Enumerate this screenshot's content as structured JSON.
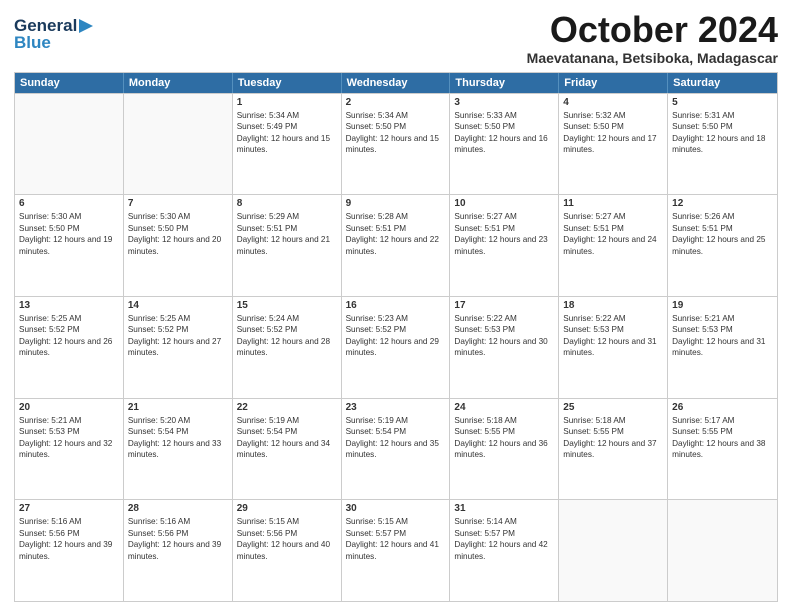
{
  "logo": {
    "line1": "General",
    "line2": "Blue"
  },
  "header": {
    "month": "October 2024",
    "location": "Maevatanana, Betsiboka, Madagascar"
  },
  "weekdays": [
    "Sunday",
    "Monday",
    "Tuesday",
    "Wednesday",
    "Thursday",
    "Friday",
    "Saturday"
  ],
  "weeks": [
    [
      {
        "day": "",
        "sunrise": "",
        "sunset": "",
        "daylight": ""
      },
      {
        "day": "",
        "sunrise": "",
        "sunset": "",
        "daylight": ""
      },
      {
        "day": "1",
        "sunrise": "Sunrise: 5:34 AM",
        "sunset": "Sunset: 5:49 PM",
        "daylight": "Daylight: 12 hours and 15 minutes."
      },
      {
        "day": "2",
        "sunrise": "Sunrise: 5:34 AM",
        "sunset": "Sunset: 5:50 PM",
        "daylight": "Daylight: 12 hours and 15 minutes."
      },
      {
        "day": "3",
        "sunrise": "Sunrise: 5:33 AM",
        "sunset": "Sunset: 5:50 PM",
        "daylight": "Daylight: 12 hours and 16 minutes."
      },
      {
        "day": "4",
        "sunrise": "Sunrise: 5:32 AM",
        "sunset": "Sunset: 5:50 PM",
        "daylight": "Daylight: 12 hours and 17 minutes."
      },
      {
        "day": "5",
        "sunrise": "Sunrise: 5:31 AM",
        "sunset": "Sunset: 5:50 PM",
        "daylight": "Daylight: 12 hours and 18 minutes."
      }
    ],
    [
      {
        "day": "6",
        "sunrise": "Sunrise: 5:30 AM",
        "sunset": "Sunset: 5:50 PM",
        "daylight": "Daylight: 12 hours and 19 minutes."
      },
      {
        "day": "7",
        "sunrise": "Sunrise: 5:30 AM",
        "sunset": "Sunset: 5:50 PM",
        "daylight": "Daylight: 12 hours and 20 minutes."
      },
      {
        "day": "8",
        "sunrise": "Sunrise: 5:29 AM",
        "sunset": "Sunset: 5:51 PM",
        "daylight": "Daylight: 12 hours and 21 minutes."
      },
      {
        "day": "9",
        "sunrise": "Sunrise: 5:28 AM",
        "sunset": "Sunset: 5:51 PM",
        "daylight": "Daylight: 12 hours and 22 minutes."
      },
      {
        "day": "10",
        "sunrise": "Sunrise: 5:27 AM",
        "sunset": "Sunset: 5:51 PM",
        "daylight": "Daylight: 12 hours and 23 minutes."
      },
      {
        "day": "11",
        "sunrise": "Sunrise: 5:27 AM",
        "sunset": "Sunset: 5:51 PM",
        "daylight": "Daylight: 12 hours and 24 minutes."
      },
      {
        "day": "12",
        "sunrise": "Sunrise: 5:26 AM",
        "sunset": "Sunset: 5:51 PM",
        "daylight": "Daylight: 12 hours and 25 minutes."
      }
    ],
    [
      {
        "day": "13",
        "sunrise": "Sunrise: 5:25 AM",
        "sunset": "Sunset: 5:52 PM",
        "daylight": "Daylight: 12 hours and 26 minutes."
      },
      {
        "day": "14",
        "sunrise": "Sunrise: 5:25 AM",
        "sunset": "Sunset: 5:52 PM",
        "daylight": "Daylight: 12 hours and 27 minutes."
      },
      {
        "day": "15",
        "sunrise": "Sunrise: 5:24 AM",
        "sunset": "Sunset: 5:52 PM",
        "daylight": "Daylight: 12 hours and 28 minutes."
      },
      {
        "day": "16",
        "sunrise": "Sunrise: 5:23 AM",
        "sunset": "Sunset: 5:52 PM",
        "daylight": "Daylight: 12 hours and 29 minutes."
      },
      {
        "day": "17",
        "sunrise": "Sunrise: 5:22 AM",
        "sunset": "Sunset: 5:53 PM",
        "daylight": "Daylight: 12 hours and 30 minutes."
      },
      {
        "day": "18",
        "sunrise": "Sunrise: 5:22 AM",
        "sunset": "Sunset: 5:53 PM",
        "daylight": "Daylight: 12 hours and 31 minutes."
      },
      {
        "day": "19",
        "sunrise": "Sunrise: 5:21 AM",
        "sunset": "Sunset: 5:53 PM",
        "daylight": "Daylight: 12 hours and 31 minutes."
      }
    ],
    [
      {
        "day": "20",
        "sunrise": "Sunrise: 5:21 AM",
        "sunset": "Sunset: 5:53 PM",
        "daylight": "Daylight: 12 hours and 32 minutes."
      },
      {
        "day": "21",
        "sunrise": "Sunrise: 5:20 AM",
        "sunset": "Sunset: 5:54 PM",
        "daylight": "Daylight: 12 hours and 33 minutes."
      },
      {
        "day": "22",
        "sunrise": "Sunrise: 5:19 AM",
        "sunset": "Sunset: 5:54 PM",
        "daylight": "Daylight: 12 hours and 34 minutes."
      },
      {
        "day": "23",
        "sunrise": "Sunrise: 5:19 AM",
        "sunset": "Sunset: 5:54 PM",
        "daylight": "Daylight: 12 hours and 35 minutes."
      },
      {
        "day": "24",
        "sunrise": "Sunrise: 5:18 AM",
        "sunset": "Sunset: 5:55 PM",
        "daylight": "Daylight: 12 hours and 36 minutes."
      },
      {
        "day": "25",
        "sunrise": "Sunrise: 5:18 AM",
        "sunset": "Sunset: 5:55 PM",
        "daylight": "Daylight: 12 hours and 37 minutes."
      },
      {
        "day": "26",
        "sunrise": "Sunrise: 5:17 AM",
        "sunset": "Sunset: 5:55 PM",
        "daylight": "Daylight: 12 hours and 38 minutes."
      }
    ],
    [
      {
        "day": "27",
        "sunrise": "Sunrise: 5:16 AM",
        "sunset": "Sunset: 5:56 PM",
        "daylight": "Daylight: 12 hours and 39 minutes."
      },
      {
        "day": "28",
        "sunrise": "Sunrise: 5:16 AM",
        "sunset": "Sunset: 5:56 PM",
        "daylight": "Daylight: 12 hours and 39 minutes."
      },
      {
        "day": "29",
        "sunrise": "Sunrise: 5:15 AM",
        "sunset": "Sunset: 5:56 PM",
        "daylight": "Daylight: 12 hours and 40 minutes."
      },
      {
        "day": "30",
        "sunrise": "Sunrise: 5:15 AM",
        "sunset": "Sunset: 5:57 PM",
        "daylight": "Daylight: 12 hours and 41 minutes."
      },
      {
        "day": "31",
        "sunrise": "Sunrise: 5:14 AM",
        "sunset": "Sunset: 5:57 PM",
        "daylight": "Daylight: 12 hours and 42 minutes."
      },
      {
        "day": "",
        "sunrise": "",
        "sunset": "",
        "daylight": ""
      },
      {
        "day": "",
        "sunrise": "",
        "sunset": "",
        "daylight": ""
      }
    ]
  ]
}
